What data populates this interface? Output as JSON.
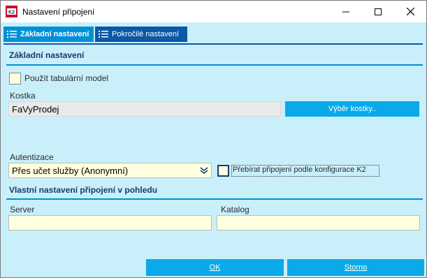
{
  "window": {
    "title": "Nastavení připojení"
  },
  "tabs": [
    {
      "label": "Základní nastavení",
      "active": true
    },
    {
      "label": "Pokročilé nastavení",
      "active": false
    }
  ],
  "basic": {
    "section_title": "Základní nastavení",
    "use_tabular_label": "Použít tabulární model",
    "kostka_label": "Kostka",
    "kostka_value": "FaVyProdej",
    "select_cube_button": "Výběr kostky..",
    "auth_label": "Autentizace",
    "auth_value": "Přes učet služby (Anonymní)",
    "take_conn_label": "Přebírat připojení podle konfigurace K2"
  },
  "custom": {
    "section_title": "Vlastní nastavení připojení v pohledu",
    "server_label": "Server",
    "server_value": "",
    "katalog_label": "Katalog",
    "katalog_value": ""
  },
  "footer": {
    "ok_label": "OK",
    "cancel_label": "Storno"
  },
  "colors": {
    "accent": "#0090d6",
    "dark_tab": "#0a58a6",
    "button": "#0aa9e8",
    "panel": "#c9effb",
    "input_bg": "#ffffe0"
  },
  "icons": {
    "app": "k2-app-icon",
    "tab": "list-icon",
    "combo": "double-chevron-down-icon"
  }
}
